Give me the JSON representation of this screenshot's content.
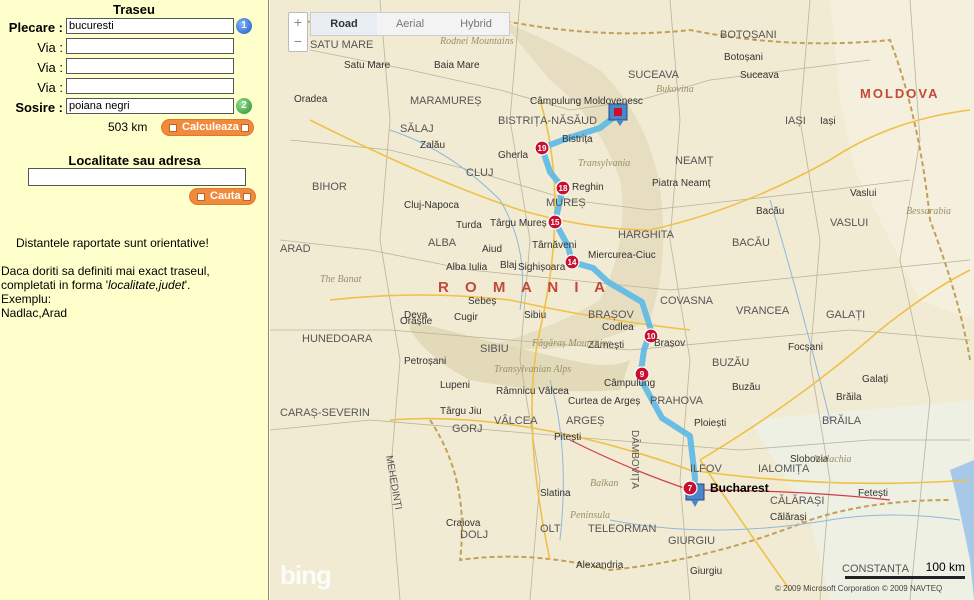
{
  "sidebar": {
    "title": "Traseu",
    "start_label": "Plecare :",
    "start_value": "bucuresti",
    "via_label": "Via :",
    "end_label": "Sosire :",
    "end_value": "poiana negri",
    "start_badge": "1",
    "end_badge": "2",
    "distance": "503 km",
    "calc_button": "Calculeaza",
    "search_title": "Localitate sau adresa",
    "search_value": "",
    "search_button": "Cauta",
    "note": "Distantele raportate sunt orientative!",
    "help_line1": "Daca doriti sa definiti mai exact traseul,",
    "help_line2_prefix": "completati in forma '",
    "help_line2_italic": "localitate,judet",
    "help_line2_suffix": "'.",
    "help_line3": "Exemplu:",
    "help_line4": "Nadlac,Arad"
  },
  "map": {
    "tabs": [
      "Road",
      "Aerial",
      "Hybrid"
    ],
    "active_tab": "Road",
    "zoom_in": "+",
    "zoom_out": "−",
    "logo": "bing",
    "scale_label": "100 km",
    "copyright": "© 2009 Microsoft Corporation   © 2009 NAVTEQ",
    "route_color": "#5bb8e6",
    "marker_color": "#c8102e",
    "route_markers": [
      "19",
      "18",
      "15",
      "14",
      "10",
      "9",
      "7"
    ],
    "labels": {
      "country": "R O M A N I A",
      "moldova": "MOLDOVA",
      "bucharest": "Bucharest",
      "regions": [
        "SATU MARE",
        "MARAMUREȘ",
        "SUCEAVA",
        "BOTOȘANI",
        "IAȘI",
        "SĂLAJ",
        "BISTRIȚA-NĂSĂUD",
        "NEAMȚ",
        "BIHOR",
        "CLUJ",
        "MUREȘ",
        "HARGHITA",
        "BACĂU",
        "VASLUI",
        "ARAD",
        "ALBA",
        "COVASNA",
        "VRANCEA",
        "GALAȚI",
        "HUNEDOARA",
        "SIBIU",
        "BRAȘOV",
        "BUZĂU",
        "BRĂILA",
        "CARAȘ-SEVERIN",
        "ARGEȘ",
        "PRAHOVA",
        "DÂMBOVIȚA",
        "IALOMIȚA",
        "GORJ",
        "VÂLCEA",
        "ILFOV",
        "CĂLĂRAȘI",
        "MEHEDINȚI",
        "DOLJ",
        "OLT",
        "TELEORMAN",
        "GIURGIU",
        "CONSTANȚA"
      ],
      "cities": [
        "Bistrița",
        "Gherla",
        "Reghin",
        "Târgu Mureș",
        "Sighișoara",
        "Miercurea-Ciuc",
        "Brașov",
        "Câmpulung",
        "Ploiești",
        "Pitești",
        "Sibiu",
        "Cluj-Napoca",
        "Zalău",
        "Suceava",
        "Piatra Neamț",
        "Bacău",
        "Focșani",
        "Buzău",
        "Câmpulung Moldovenesc",
        "Râmnicu Vâlcea",
        "Târgu Jiu",
        "Craiova",
        "Slatina",
        "Alexandria",
        "Deva",
        "Alba Iulia",
        "Oradea",
        "Satu Mare",
        "Baia Mare",
        "Vaslui",
        "Galați",
        "Brăila",
        "Slobozia",
        "Călărași",
        "Giurgiu",
        "Iași",
        "Botoșani",
        "Fetești",
        "Târnăveni",
        "Codlea",
        "Zărnești",
        "Curtea de Argeș",
        "Lupeni",
        "Petroșani",
        "Orăștie",
        "Sebeș",
        "Cugir",
        "Blaj",
        "Aiud",
        "Turda"
      ],
      "mountains": [
        "Rodnei Mountains",
        "Transylvania",
        "Făgăraș Mountains",
        "Transylvanian Alps",
        "The Banat",
        "Bukovina",
        "Balkan",
        "Peninsula",
        "Walachia",
        "Bessarabia"
      ]
    }
  }
}
